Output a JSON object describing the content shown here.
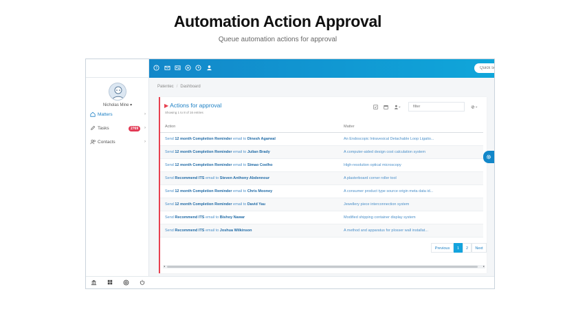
{
  "hero": {
    "title": "Automation Action Approval",
    "subtitle": "Queue automation actions for approval"
  },
  "topbar": {
    "icons": [
      "help-icon",
      "mail-icon",
      "id-card-icon",
      "play-icon",
      "clock-icon",
      "user-upload-icon"
    ],
    "search_placeholder": "Quick search...",
    "right_icons": [
      "robot-icon",
      "grid-icon"
    ]
  },
  "sidebar": {
    "user_name": "Nicholas Mine",
    "items": [
      {
        "label": "Matters",
        "icon": "home-icon"
      },
      {
        "label": "Tasks",
        "icon": "pencil-icon",
        "badge": "2769"
      },
      {
        "label": "Contacts",
        "icon": "contacts-icon"
      }
    ]
  },
  "breadcrumb": [
    "Patentec",
    "Dashboard"
  ],
  "panel": {
    "title": "Actions for approval",
    "subtitle": "Showing 1 to 8 of 16 entries",
    "filter_placeholder": "filter"
  },
  "table": {
    "columns": [
      "Action",
      "Matter"
    ],
    "rows": [
      {
        "pre": "Send ",
        "item": "12 month Completion Reminder",
        "mid": " email to ",
        "person": "Dinesh Agarwal",
        "matter": "An Endoscopic Intravesical Detachable Loop Ligatio..."
      },
      {
        "pre": "Send ",
        "item": "12 month Completion Reminder",
        "mid": " email to ",
        "person": "Julian Brady",
        "matter": "A computer-aided design cost calculation system"
      },
      {
        "pre": "Send ",
        "item": "12 month Completion Reminder",
        "mid": " email to ",
        "person": "Simao Coelho",
        "matter": "High-resolution optical microscopy"
      },
      {
        "pre": "Send ",
        "item": "Recommend ITS",
        "mid": " email to ",
        "person": "Steven Anthony Abdennour",
        "matter": "A plasterboard corner roller tool"
      },
      {
        "pre": "Send ",
        "item": "12 month Completion Reminder",
        "mid": " email to ",
        "person": "Chris Mooney",
        "matter": "A consumer product type source origin meta data id..."
      },
      {
        "pre": "Send ",
        "item": "12 month Completion Reminder",
        "mid": " email to ",
        "person": "David Yau",
        "matter": "Jewellery piece interconnection system"
      },
      {
        "pre": "Send ",
        "item": "Recommend ITS",
        "mid": " email to ",
        "person": "Bishoy Nawar",
        "matter": "Modified shipping container display system"
      },
      {
        "pre": "Send ",
        "item": "Recommend ITS",
        "mid": " email to ",
        "person": "Joshua Wilkinson",
        "matter": "A method and apparatus for plosser wall installat..."
      }
    ]
  },
  "pagination": {
    "previous": "Previous",
    "pages": [
      "1",
      "2"
    ],
    "current": "1",
    "next": "Next"
  },
  "footer_icons": [
    "bank-icon",
    "grid-icon",
    "support-icon",
    "power-icon"
  ],
  "colors": {
    "topbar": "#1287c9",
    "accent": "#13a3dd",
    "badge": "#e23a55",
    "panel_border": "#e8404f"
  }
}
